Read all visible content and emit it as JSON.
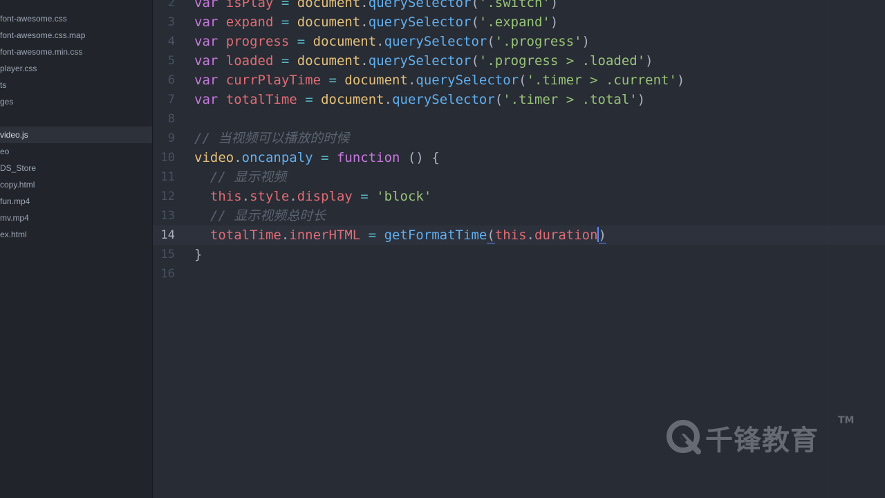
{
  "file_tree": {
    "items": [
      {
        "label": "font-awesome.css"
      },
      {
        "label": "font-awesome.css.map"
      },
      {
        "label": "font-awesome.min.css"
      },
      {
        "label": "player.css"
      },
      {
        "label": "ts"
      },
      {
        "label": "ges"
      },
      {
        "label": "video.js",
        "selected": true
      },
      {
        "label": "eo"
      },
      {
        "label": "DS_Store"
      },
      {
        "label": "copy.html"
      },
      {
        "label": "fun.mp4"
      },
      {
        "label": "mv.mp4"
      },
      {
        "label": "ex.html"
      }
    ]
  },
  "editor": {
    "cursor_line": "14",
    "lines": [
      {
        "num": "2",
        "tokens": [
          {
            "t": "var",
            "c": "kw"
          },
          {
            "t": " "
          },
          {
            "t": "isPlay",
            "c": "var"
          },
          {
            "t": " "
          },
          {
            "t": "=",
            "c": "op"
          },
          {
            "t": " "
          },
          {
            "t": "document",
            "c": "cls"
          },
          {
            "t": "."
          },
          {
            "t": "querySelector",
            "c": "fn"
          },
          {
            "t": "("
          },
          {
            "t": "'.switch'",
            "c": "str"
          },
          {
            "t": ")"
          }
        ]
      },
      {
        "num": "3",
        "tokens": [
          {
            "t": "var",
            "c": "kw"
          },
          {
            "t": " "
          },
          {
            "t": "expand",
            "c": "var"
          },
          {
            "t": " "
          },
          {
            "t": "=",
            "c": "op"
          },
          {
            "t": " "
          },
          {
            "t": "document",
            "c": "cls"
          },
          {
            "t": "."
          },
          {
            "t": "querySelector",
            "c": "fn"
          },
          {
            "t": "("
          },
          {
            "t": "'.expand'",
            "c": "str"
          },
          {
            "t": ")"
          }
        ]
      },
      {
        "num": "4",
        "tokens": [
          {
            "t": "var",
            "c": "kw"
          },
          {
            "t": " "
          },
          {
            "t": "progress",
            "c": "var"
          },
          {
            "t": " "
          },
          {
            "t": "=",
            "c": "op"
          },
          {
            "t": " "
          },
          {
            "t": "document",
            "c": "cls"
          },
          {
            "t": "."
          },
          {
            "t": "querySelector",
            "c": "fn"
          },
          {
            "t": "("
          },
          {
            "t": "'.progress'",
            "c": "str"
          },
          {
            "t": ")"
          }
        ]
      },
      {
        "num": "5",
        "tokens": [
          {
            "t": "var",
            "c": "kw"
          },
          {
            "t": " "
          },
          {
            "t": "loaded",
            "c": "var"
          },
          {
            "t": " "
          },
          {
            "t": "=",
            "c": "op"
          },
          {
            "t": " "
          },
          {
            "t": "document",
            "c": "cls"
          },
          {
            "t": "."
          },
          {
            "t": "querySelector",
            "c": "fn"
          },
          {
            "t": "("
          },
          {
            "t": "'.progress > .loaded'",
            "c": "str"
          },
          {
            "t": ")"
          }
        ]
      },
      {
        "num": "6",
        "tokens": [
          {
            "t": "var",
            "c": "kw"
          },
          {
            "t": " "
          },
          {
            "t": "currPlayTime",
            "c": "var"
          },
          {
            "t": " "
          },
          {
            "t": "=",
            "c": "op"
          },
          {
            "t": " "
          },
          {
            "t": "document",
            "c": "cls"
          },
          {
            "t": "."
          },
          {
            "t": "querySelector",
            "c": "fn"
          },
          {
            "t": "("
          },
          {
            "t": "'.timer > .current'",
            "c": "str"
          },
          {
            "t": ")"
          }
        ]
      },
      {
        "num": "7",
        "tokens": [
          {
            "t": "var",
            "c": "kw"
          },
          {
            "t": " "
          },
          {
            "t": "totalTime",
            "c": "var"
          },
          {
            "t": " "
          },
          {
            "t": "=",
            "c": "op"
          },
          {
            "t": " "
          },
          {
            "t": "document",
            "c": "cls"
          },
          {
            "t": "."
          },
          {
            "t": "querySelector",
            "c": "fn"
          },
          {
            "t": "("
          },
          {
            "t": "'.timer > .total'",
            "c": "str"
          },
          {
            "t": ")"
          }
        ]
      },
      {
        "num": "8",
        "tokens": []
      },
      {
        "num": "9",
        "tokens": [
          {
            "t": "// 当视频可以播放的时候",
            "c": "cmt"
          }
        ]
      },
      {
        "num": "10",
        "tokens": [
          {
            "t": "video",
            "c": "cls"
          },
          {
            "t": "."
          },
          {
            "t": "oncanpaly",
            "c": "fn"
          },
          {
            "t": " "
          },
          {
            "t": "=",
            "c": "op"
          },
          {
            "t": " "
          },
          {
            "t": "function",
            "c": "kw"
          },
          {
            "t": " () {"
          }
        ]
      },
      {
        "num": "11",
        "tokens": [
          {
            "t": "  "
          },
          {
            "t": "// 显示视频",
            "c": "cmt"
          }
        ]
      },
      {
        "num": "12",
        "tokens": [
          {
            "t": "  "
          },
          {
            "t": "this",
            "c": "var"
          },
          {
            "t": "."
          },
          {
            "t": "style",
            "c": "var"
          },
          {
            "t": "."
          },
          {
            "t": "display",
            "c": "var"
          },
          {
            "t": " "
          },
          {
            "t": "=",
            "c": "op"
          },
          {
            "t": " "
          },
          {
            "t": "'block'",
            "c": "str"
          }
        ]
      },
      {
        "num": "13",
        "tokens": [
          {
            "t": "  "
          },
          {
            "t": "// 显示视频总时长",
            "c": "cmt"
          }
        ]
      },
      {
        "num": "14",
        "tokens": [
          {
            "t": "  "
          },
          {
            "t": "totalTime",
            "c": "var"
          },
          {
            "t": "."
          },
          {
            "t": "innerHTML",
            "c": "var"
          },
          {
            "t": " "
          },
          {
            "t": "=",
            "c": "op"
          },
          {
            "t": " "
          },
          {
            "t": "getFormatTime",
            "c": "fn"
          },
          {
            "t": "(",
            "c": "pun bm"
          },
          {
            "t": "this",
            "c": "var"
          },
          {
            "t": "."
          },
          {
            "t": "duration",
            "c": "var"
          },
          {
            "t": "",
            "caret": true
          },
          {
            "t": ")",
            "c": "pun bm"
          }
        ]
      },
      {
        "num": "15",
        "tokens": [
          {
            "t": "}"
          }
        ]
      },
      {
        "num": "16",
        "tokens": []
      }
    ]
  },
  "watermark": {
    "text": "千锋教育",
    "tm": "TM"
  }
}
